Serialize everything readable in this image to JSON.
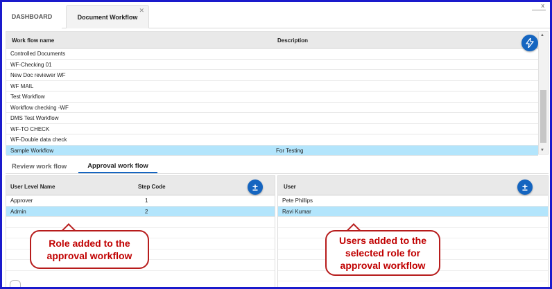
{
  "tabs": {
    "dashboard": "DASHBOARD",
    "document_workflow": "Document Workflow",
    "tab_close": "✕",
    "window_close": "x"
  },
  "workflow_grid": {
    "columns": [
      "Work flow name",
      "Description"
    ],
    "rows": [
      {
        "name": "Controlled Documents",
        "description": ""
      },
      {
        "name": "WF-Checking 01",
        "description": ""
      },
      {
        "name": "New Doc reviewer WF",
        "description": ""
      },
      {
        "name": "WF MAIL",
        "description": ""
      },
      {
        "name": "Test Workflow",
        "description": ""
      },
      {
        "name": "Workflow checking -WF",
        "description": ""
      },
      {
        "name": "DMS Test Workflow",
        "description": ""
      },
      {
        "name": "WF-TO CHECK",
        "description": ""
      },
      {
        "name": "WF-Double data check",
        "description": ""
      },
      {
        "name": "Sample Workflow",
        "description": "For Testing"
      }
    ],
    "selected_index": 9,
    "action_icon": "lightning-icon"
  },
  "subtabs": {
    "review": "Review work flow",
    "approval": "Approval work flow",
    "active": "approval"
  },
  "role_grid": {
    "columns": [
      "User Level Name",
      "Step Code"
    ],
    "rows": [
      {
        "name": "Approver",
        "step": "1"
      },
      {
        "name": "Admin",
        "step": "2"
      }
    ],
    "selected_index": 1,
    "add_icon": "plus-minus-icon",
    "add_symbol": "±"
  },
  "user_grid": {
    "columns": [
      "User"
    ],
    "rows": [
      {
        "name": "Pete Phillips"
      },
      {
        "name": "Ravi Kumar"
      }
    ],
    "selected_index": 1,
    "add_icon": "plus-minus-icon",
    "add_symbol": "±"
  },
  "callouts": {
    "role": "Role added to the\napproval workflow",
    "users": "Users added to the\nselected role for\napproval workflow"
  },
  "colors": {
    "frame": "#1a1acc",
    "selected_row": "#b3e5fc",
    "accent": "#1565c0",
    "callout": "#b71c1c"
  }
}
